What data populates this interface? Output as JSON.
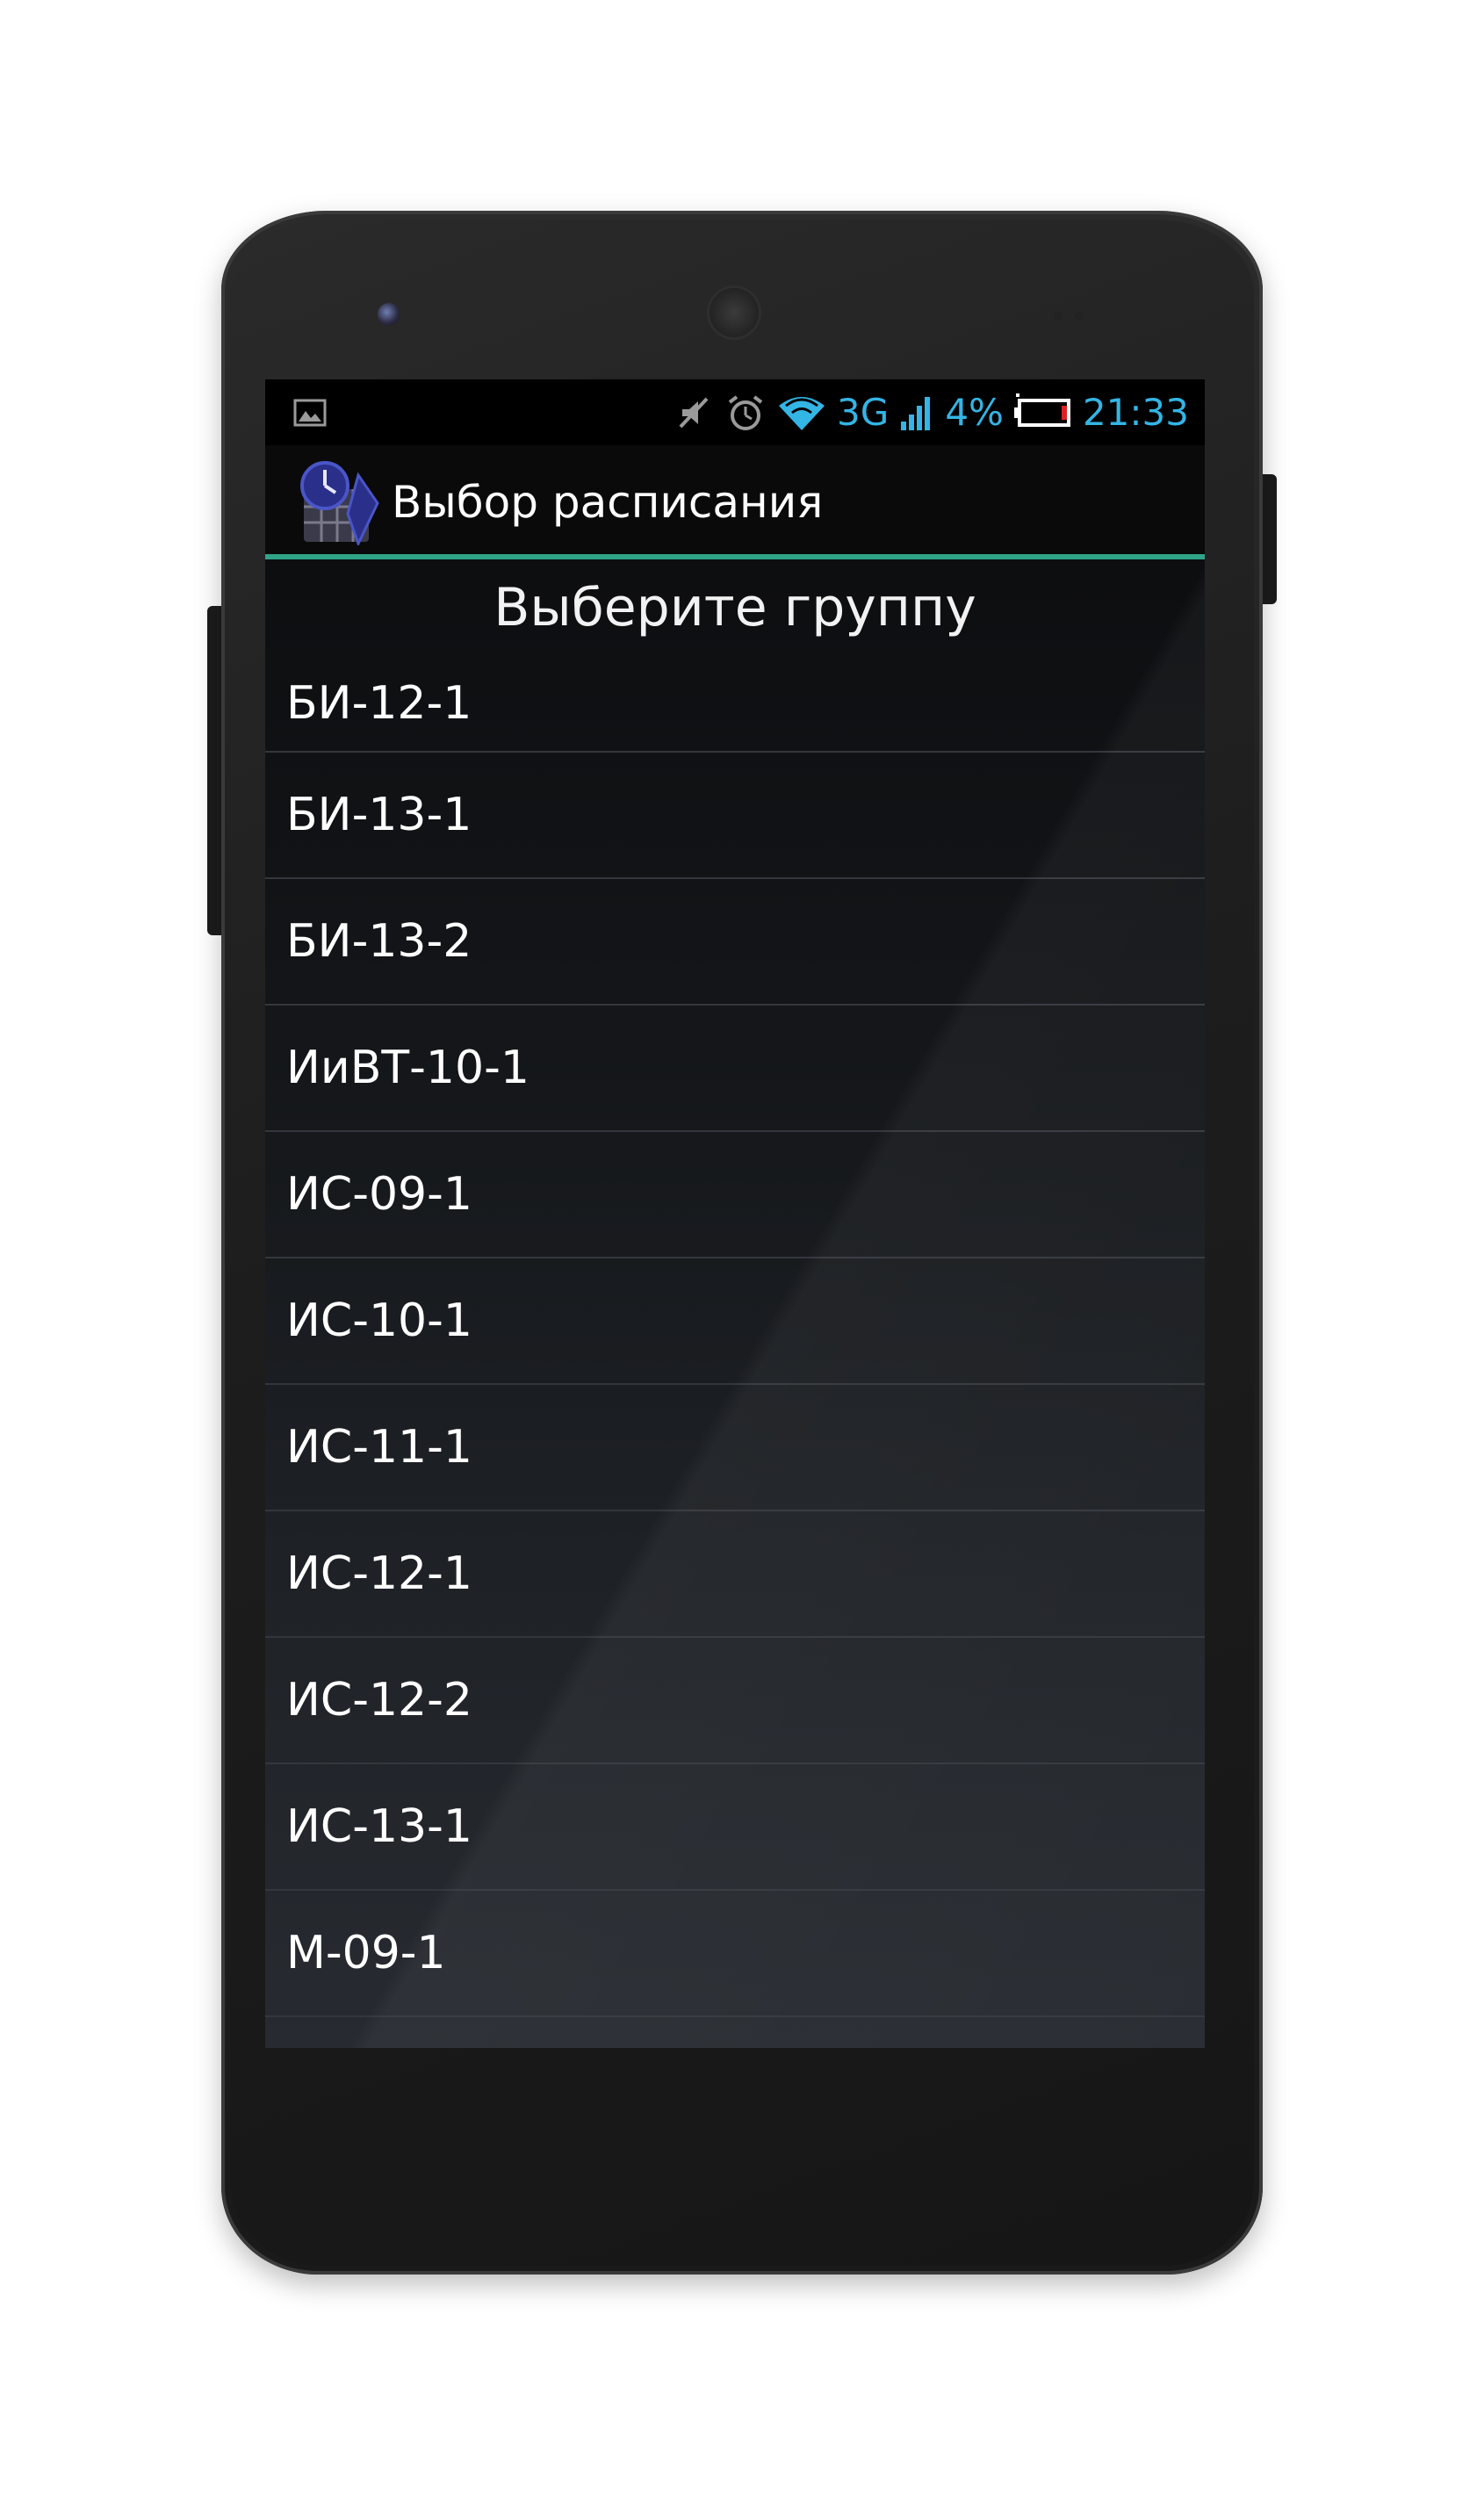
{
  "status_bar": {
    "network_type": "3G",
    "battery_percent": "4%",
    "time": "21:33",
    "icons": [
      "image-icon",
      "muted-icon",
      "alarm-icon",
      "wifi-icon",
      "signal-icon",
      "battery-icon"
    ],
    "accent_color": "#33b5e5"
  },
  "action_bar": {
    "title": "Выбор расписания",
    "divider_color": "#2fa386"
  },
  "list": {
    "header": "Выберите группу",
    "items": [
      {
        "label": "БИ-12-1"
      },
      {
        "label": "БИ-13-1"
      },
      {
        "label": "БИ-13-2"
      },
      {
        "label": "ИиВТ-10-1"
      },
      {
        "label": "ИС-09-1"
      },
      {
        "label": "ИС-10-1"
      },
      {
        "label": "ИС-11-1"
      },
      {
        "label": "ИС-12-1"
      },
      {
        "label": "ИС-12-2"
      },
      {
        "label": "ИС-13-1"
      },
      {
        "label": "М-09-1"
      }
    ]
  }
}
